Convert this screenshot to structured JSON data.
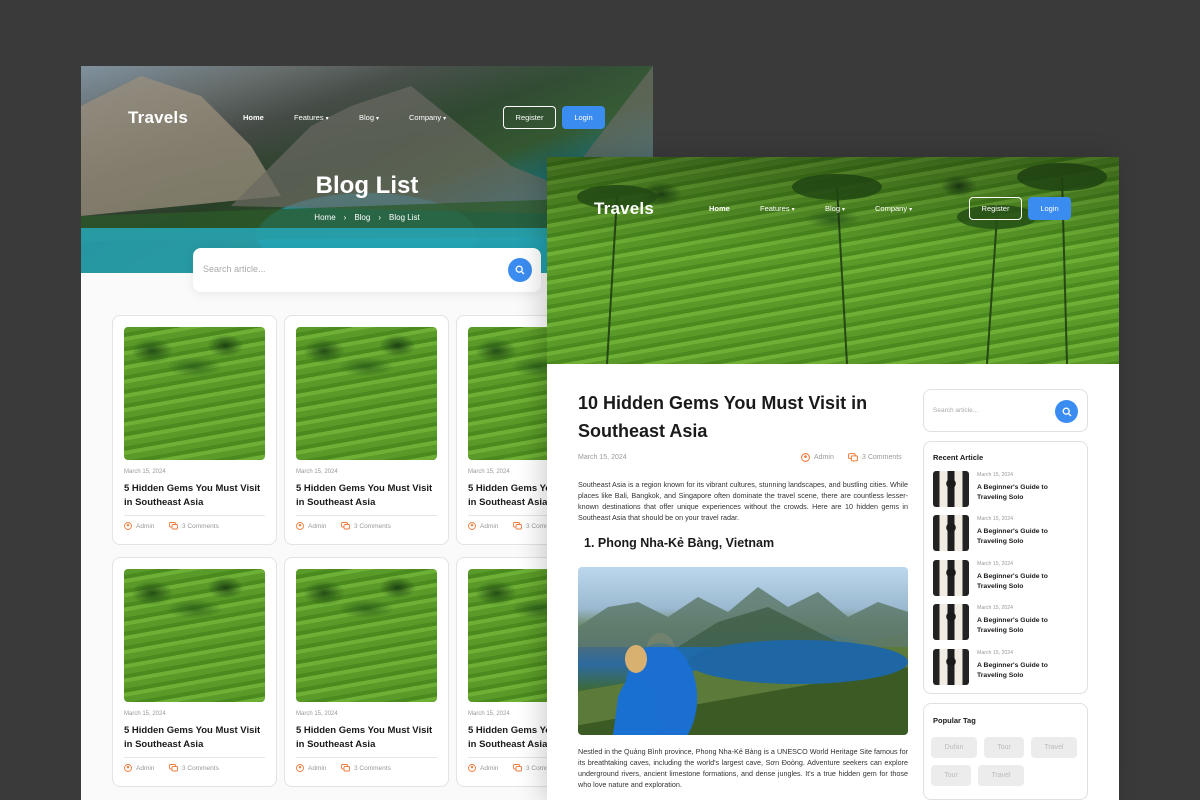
{
  "brand": "Travels",
  "nav": {
    "home": "Home",
    "features": "Features",
    "blog": "Blog",
    "company": "Company",
    "register": "Register",
    "login": "Login"
  },
  "blog_list": {
    "title": "Blog List",
    "breadcrumb": [
      "Home",
      "Blog",
      "Blog List"
    ],
    "search_placeholder": "Search article...",
    "cards": [
      {
        "date": "March 15, 2024",
        "title": "5 Hidden Gems You Must Visit in Southeast Asia",
        "author": "Admin",
        "comments": "3 Comments"
      },
      {
        "date": "March 15, 2024",
        "title": "5 Hidden Gems You Must Visit in Southeast Asia",
        "author": "Admin",
        "comments": "3 Comments"
      },
      {
        "date": "March 15, 2024",
        "title": "5 Hidden Gems You Must Visit in Southeast Asia",
        "author": "Admin",
        "comments": "3 Comments"
      },
      {
        "date": "March 15, 2024",
        "title": "5 Hidden Gems You Must Visit in Southeast Asia",
        "author": "Admin",
        "comments": "3 Comments"
      },
      {
        "date": "March 15, 2024",
        "title": "5 Hidden Gems You Must Visit in Southeast Asia",
        "author": "Admin",
        "comments": "3 Comments"
      },
      {
        "date": "March 15, 2024",
        "title": "5 Hidden Gems You Must Visit in Southeast Asia",
        "author": "Admin",
        "comments": "3 Comments"
      }
    ]
  },
  "article": {
    "title": "10 Hidden Gems You Must Visit in Southeast Asia",
    "date": "March 15, 2024",
    "author": "Admin",
    "comments": "3 Comments",
    "intro": "Southeast Asia is a region known for its vibrant cultures, stunning landscapes, and bustling cities. While places like Bali, Bangkok, and Singapore often dominate the travel scene, there are countless lesser-known destinations that offer unique experiences without the crowds. Here are 10 hidden gems in Southeast Asia that should be on your travel radar.",
    "section_heading": "1.  Phong Nha-Kẻ Bàng, Vietnam",
    "section_text": "Nestled in the Quảng Bình province, Phong Nha-Kẻ Bàng is a UNESCO World Heritage Site famous for its breathtaking caves, including the world's largest cave, Sơn Đoòng. Adventure seekers can explore underground rivers, ancient limestone formations, and dense jungles. It's a true hidden gem for those who love nature and exploration."
  },
  "sidebar": {
    "search_placeholder": "Search article...",
    "recent_heading": "Recent Article",
    "recent": [
      {
        "date": "March 15, 2024",
        "title": "A Beginner's Guide to Traveling Solo"
      },
      {
        "date": "March 15, 2024",
        "title": "A Beginner's Guide to Traveling Solo"
      },
      {
        "date": "March 15, 2024",
        "title": "A Beginner's Guide to Traveling Solo"
      },
      {
        "date": "March 15, 2024",
        "title": "A Beginner's Guide to Traveling Solo"
      },
      {
        "date": "March 15, 2024",
        "title": "A Beginner's Guide to Traveling Solo"
      }
    ],
    "tags_heading": "Popular Tag",
    "tags": [
      "Dufan",
      "Tour",
      "Travel",
      "Tour",
      "Travel"
    ]
  },
  "colors": {
    "accent": "#3b8cf0",
    "meta_icon": "#f07a3a",
    "backdrop": "#3a3a3a"
  },
  "icons": {
    "search": "search-icon",
    "author": "user-icon",
    "comments": "comment-icon",
    "dropdown": "chevron-down-icon",
    "breadcrumb_sep": "chevron-right-icon"
  }
}
